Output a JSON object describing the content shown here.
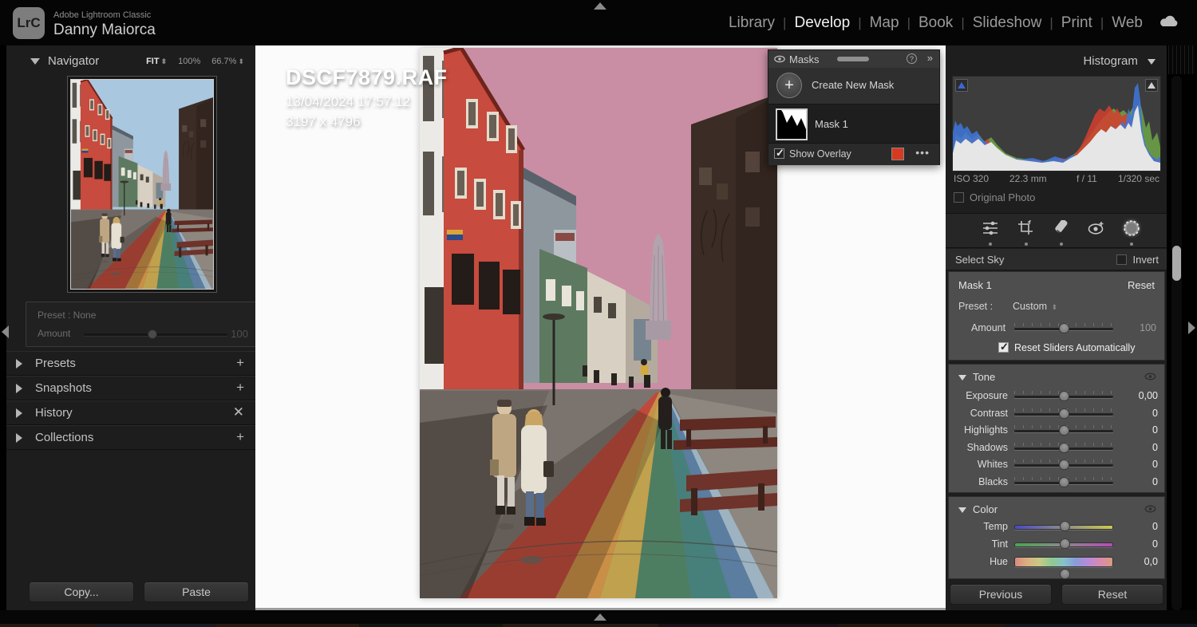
{
  "app": {
    "logo_text": "LrC",
    "name": "Adobe Lightroom Classic",
    "user": "Danny Maiorca"
  },
  "top_nav": {
    "items": [
      {
        "label": "Library",
        "active": false
      },
      {
        "label": "Develop",
        "active": true
      },
      {
        "label": "Map",
        "active": false
      },
      {
        "label": "Book",
        "active": false
      },
      {
        "label": "Slideshow",
        "active": false
      },
      {
        "label": "Print",
        "active": false
      },
      {
        "label": "Web",
        "active": false
      }
    ]
  },
  "left_panel": {
    "navigator": {
      "title": "Navigator",
      "fit_label": "FIT",
      "zoom_fixed": "100%",
      "zoom_custom": "66.7%"
    },
    "preset_box": {
      "preset_label": "Preset : None",
      "amount_label": "Amount",
      "amount_value": "100"
    },
    "sections": [
      {
        "label": "Presets",
        "action": "plus"
      },
      {
        "label": "Snapshots",
        "action": "plus"
      },
      {
        "label": "History",
        "action": "close"
      },
      {
        "label": "Collections",
        "action": "plus"
      }
    ],
    "copy_label": "Copy...",
    "paste_label": "Paste"
  },
  "canvas": {
    "filename": "DSCF7879.RAF",
    "datetime": "13/04/2024 17:57:12",
    "dimensions": "3197 x 4796"
  },
  "masks_panel": {
    "title": "Masks",
    "create_label": "Create New Mask",
    "mask_name": "Mask 1",
    "show_overlay_label": "Show Overlay",
    "show_overlay_checked": true,
    "overlay_color": "#d63a20",
    "more_label": "•••",
    "collapse_label": "»",
    "help_label": "?"
  },
  "right_panel": {
    "histogram": {
      "title": "Histogram",
      "iso": "ISO 320",
      "focal_length": "22.3 mm",
      "aperture": "f / 11",
      "shutter": "1/320 sec",
      "original_photo_label": "Original Photo",
      "original_photo_checked": false
    },
    "tools": [
      {
        "name": "adjust",
        "dot": true,
        "active": false
      },
      {
        "name": "crop",
        "dot": true,
        "active": false
      },
      {
        "name": "heal",
        "dot": true,
        "active": false
      },
      {
        "name": "red-eye",
        "dot": false,
        "active": false
      },
      {
        "name": "masking",
        "dot": true,
        "active": true
      }
    ],
    "mask_bar": {
      "mode": "Select Sky",
      "invert_label": "Invert",
      "invert_checked": false
    },
    "mask_settings": {
      "name": "Mask 1",
      "reset_label": "Reset",
      "preset_label": "Preset :",
      "preset_value": "Custom",
      "amount_label": "Amount",
      "amount_value": "100",
      "auto_reset_label": "Reset Sliders Automatically",
      "auto_reset_checked": true
    },
    "tone": {
      "title": "Tone",
      "sliders": [
        {
          "label": "Exposure",
          "value": "0,00",
          "track": "plain"
        },
        {
          "label": "Contrast",
          "value": "0",
          "track": "plain"
        },
        {
          "label": "Highlights",
          "value": "0",
          "track": "plain"
        },
        {
          "label": "Shadows",
          "value": "0",
          "track": "plain"
        },
        {
          "label": "Whites",
          "value": "0",
          "track": "plain"
        },
        {
          "label": "Blacks",
          "value": "0",
          "track": "plain"
        }
      ]
    },
    "color": {
      "title": "Color",
      "sliders": [
        {
          "label": "Temp",
          "value": "0",
          "track": "temp"
        },
        {
          "label": "Tint",
          "value": "0",
          "track": "tint"
        },
        {
          "label": "Hue",
          "value": "0,0",
          "track": "hue"
        }
      ]
    },
    "previous_label": "Previous",
    "reset_label": "Reset"
  },
  "colors": {
    "sky_masked": "#c98ea4",
    "sky_original": "#a9c7df",
    "mask_overlay_red": "#d63a20",
    "canvas_bg": "#fbfbfb"
  }
}
